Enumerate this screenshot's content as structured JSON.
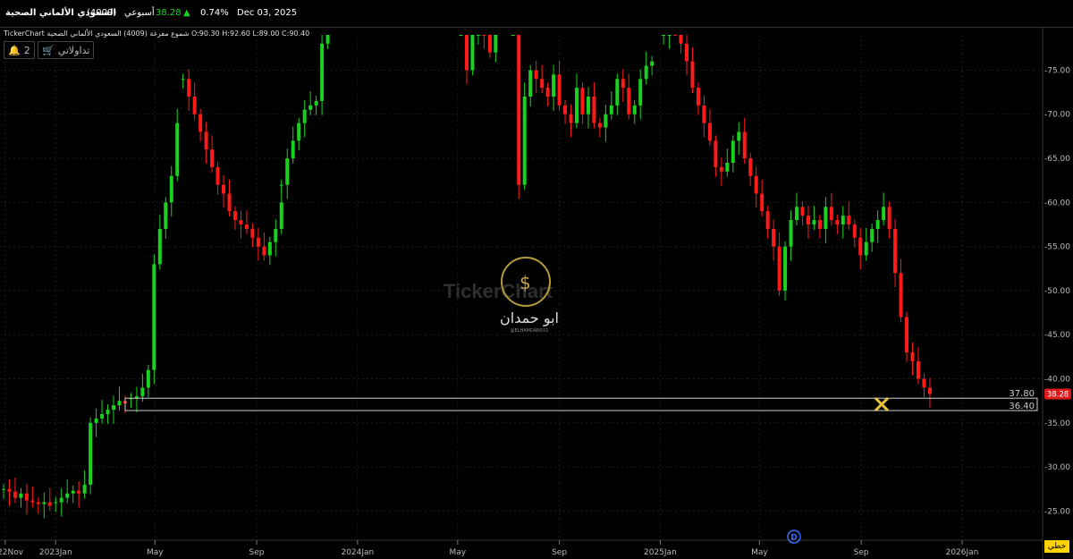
{
  "header": {
    "stock_name": "السعودي الألماني الصحية",
    "code": "(4009)",
    "period": "أسبوعي",
    "price": "38.28",
    "change_arrow": "▲",
    "change_pct": "0.74%",
    "date": "Dec 03, 2025"
  },
  "legend": {
    "source": "TickerChart",
    "line": "شموع مفرغة (4009) السعودي الألماني الصحية",
    "open": "O:90.30",
    "high": "H:92.60",
    "low": "L:89.00",
    "close": "C:90.40"
  },
  "controls": {
    "alerts_count": "2",
    "bell": "bell-icon",
    "brand_button": "تداولاتي",
    "cart": "cart-icon",
    "footer_button": "خطي"
  },
  "watermark": {
    "text": "TickerChart",
    "logo_text": "ابو حمدان",
    "logo_sub": "@ELHAMDAN551"
  },
  "colors": {
    "up": "#19d21f",
    "down": "#ff1a1a",
    "price_tag": "#e01a1a",
    "background": "#000000",
    "support_box": "#cfcfcf"
  },
  "chart_data": {
    "type": "candlestick",
    "interval": "weekly",
    "ylim": [
      22,
      79
    ],
    "yticks": [
      25,
      30,
      35,
      40,
      45,
      50,
      55,
      60,
      65,
      70,
      75
    ],
    "ytick_labels": [
      "25.00",
      "30.00",
      "35.00",
      "40.00",
      "45.00",
      "50.00",
      "55.00",
      "60.00",
      "65.00",
      "70.00",
      "75.00"
    ],
    "xticks": [
      {
        "label": "2022Nov",
        "date": "2022-11-01"
      },
      {
        "label": "2023Jan",
        "date": "2023-01-01"
      },
      {
        "label": "May",
        "date": "2023-05-01"
      },
      {
        "label": "Sep",
        "date": "2023-09-01"
      },
      {
        "label": "2024Jan",
        "date": "2024-01-01"
      },
      {
        "label": "May",
        "date": "2024-05-01"
      },
      {
        "label": "Sep",
        "date": "2024-09-01"
      },
      {
        "label": "2025Jan",
        "date": "2025-01-01"
      },
      {
        "label": "May",
        "date": "2025-05-01"
      },
      {
        "label": "Sep",
        "date": "2025-09-01"
      },
      {
        "label": "2026Jan",
        "date": "2026-01-01"
      }
    ],
    "last_price": "38.28",
    "support_zone": {
      "upper": 37.8,
      "lower": 36.4,
      "upper_label": "37.80",
      "lower_label": "36.40"
    },
    "dividend_marker": "D",
    "segments": [
      {
        "from": "2022-10-30",
        "to": "2022-12-25",
        "points": [
          27.5,
          27.2,
          26.5,
          27.0,
          26.2,
          26.0,
          25.8,
          26.0,
          25.6
        ]
      },
      {
        "from": "2023-01-01",
        "to": "2023-03-26",
        "points": [
          26.0,
          26.5,
          27.0,
          27.3,
          27.0,
          28.0,
          35.0,
          35.5,
          36.0,
          36.5,
          37.0,
          37.5,
          37.2
        ]
      },
      {
        "from": "2023-04-02",
        "to": "2023-05-28",
        "points": [
          37.8,
          38.0,
          39.0,
          41.0,
          53.0,
          57.0,
          60.0,
          63.0,
          69.0
        ]
      },
      {
        "from": "2023-06-04",
        "to": "2023-09-24",
        "points": [
          74.0,
          72.0,
          70.0,
          68.0,
          66.0,
          64.0,
          62.0,
          61.0,
          59.0,
          58.0,
          57.5,
          57.0,
          56.0,
          55.0,
          54.0,
          55.5,
          57.0,
          60.0
        ]
      },
      {
        "from": "2023-10-01",
        "to": "2023-11-26",
        "points": [
          62.0,
          65.0,
          67.0,
          69.0,
          70.5,
          71.0,
          71.5,
          78.0,
          80.0
        ]
      },
      {
        "from": "2024-05-05",
        "to": "2024-06-16",
        "points": [
          80.0,
          75.0,
          79.0,
          80.0,
          79.0,
          77.0,
          80.0
        ]
      },
      {
        "from": "2024-07-07",
        "to": "2024-12-29",
        "points": [
          80.0,
          62.0,
          72.0,
          75.0,
          74.0,
          73.0,
          72.0,
          74.5,
          71.0,
          70.0,
          69.0,
          73.0,
          70.0,
          72.0,
          69.0,
          68.5,
          70.0,
          71.0,
          74.0,
          73.0,
          70.0,
          71.0,
          74.0,
          75.5,
          76.0
        ]
      },
      {
        "from": "2025-01-05",
        "to": "2025-12-03",
        "points": [
          79.0,
          80.0,
          79.5,
          78.0,
          76.0,
          73.0,
          71.0,
          69.0,
          67.0,
          64.0,
          63.5,
          64.5,
          67.0,
          68.0,
          65.0,
          63.0,
          61.0,
          59.0,
          57.0,
          55.0,
          50.0,
          55.0,
          58.0,
          59.5,
          58.5,
          57.5,
          58.0,
          57.0,
          59.5,
          58.0,
          57.5,
          58.5,
          57.5,
          56.0,
          54.0,
          55.5,
          57.0,
          58.0,
          59.5,
          57.0,
          52.0,
          47.0,
          43.0,
          42.0,
          40.0,
          39.0,
          38.28
        ]
      }
    ]
  }
}
